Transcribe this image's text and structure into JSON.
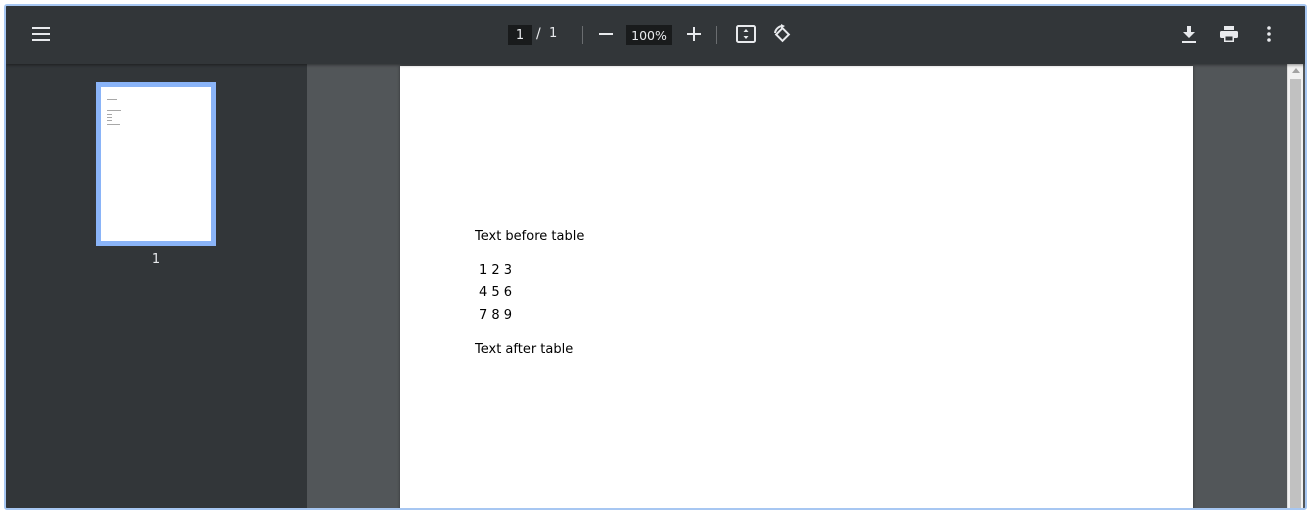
{
  "toolbar": {
    "menu_icon": "hamburger-menu-icon",
    "current_page": "1",
    "page_separator": "/",
    "total_pages": "1",
    "zoom_level": "100%",
    "zoom_out_icon": "minus-icon",
    "zoom_in_icon": "plus-icon",
    "fit_icon": "fit-to-page-icon",
    "rotate_icon": "rotate-icon",
    "download_icon": "download-icon",
    "print_icon": "print-icon",
    "more_icon": "more-vertical-icon",
    "text_color": "#e8eaed",
    "background": "#323639"
  },
  "sidebar": {
    "thumbnails": [
      {
        "label": "1",
        "selected": true
      }
    ],
    "selected_border": "#8ab4f8"
  },
  "document": {
    "text_before": "Text before table",
    "table_rows": [
      "1 2 3",
      "4 5 6",
      "7 8 9"
    ],
    "text_after": "Text after table"
  },
  "viewer": {
    "background": "#525659"
  }
}
